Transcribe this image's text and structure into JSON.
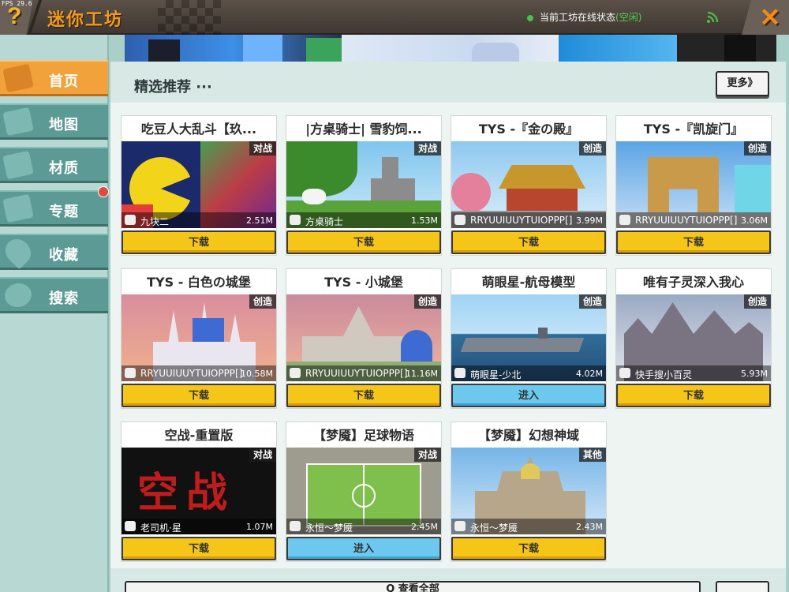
{
  "topbar": {
    "fps": "FPS 29.6",
    "help_icon": "?",
    "app_title": "迷你工坊",
    "status_label": "当前工坊在线状态",
    "status_value": "(空闲)",
    "close_icon": "✕"
  },
  "sidebar": {
    "items": [
      {
        "label": "首页",
        "icon": "home-icon",
        "active": true
      },
      {
        "label": "地图",
        "icon": "map-icon"
      },
      {
        "label": "材质",
        "icon": "texture-icon"
      },
      {
        "label": "专题",
        "icon": "topic-icon"
      },
      {
        "label": "收藏",
        "icon": "heart-icon"
      },
      {
        "label": "搜索",
        "icon": "search-icon"
      }
    ]
  },
  "main": {
    "section_title": "精选推荐 ···",
    "more_label": "更多》",
    "view_all_label": "Q 查看全部"
  },
  "cards": [
    {
      "title": "吃豆人大乱斗【玖...",
      "tag": "对战",
      "author": "九块二",
      "size": "2.51M",
      "button": "下载",
      "button_type": "download",
      "theme": "pacman"
    },
    {
      "title": "|方桌骑士| 雪豹饲...",
      "tag": "对战",
      "author": "方桌骑士",
      "size": "1.53M",
      "button": "下载",
      "button_type": "download",
      "theme": "forest"
    },
    {
      "title": "TYS -『金の殿』",
      "tag": "创造",
      "author": "RRYUUIUUYTUIOPPP[][]",
      "size": "3.99M",
      "button": "下载",
      "button_type": "download",
      "theme": "temple"
    },
    {
      "title": "TYS -『凯旋门』",
      "tag": "创造",
      "author": "RRYUUIUUYTUIOPPP[][]",
      "size": "3.06M",
      "button": "下载",
      "button_type": "download",
      "theme": "arch"
    },
    {
      "title": "TYS - 白色の城堡",
      "tag": "创造",
      "author": "RRYUUIUUYTUIOPPP[][]",
      "size": "10.58M",
      "button": "下载",
      "button_type": "download",
      "theme": "castle-white"
    },
    {
      "title": "TYS - 小城堡",
      "tag": "创造",
      "author": "RRYUUIUUYTUIOPPP[][]",
      "size": "11.16M",
      "button": "下载",
      "button_type": "download",
      "theme": "castle-small"
    },
    {
      "title": "萌眼星-航母模型",
      "tag": "创造",
      "author": "萌眼星-少北",
      "size": "4.02M",
      "button": "进入",
      "button_type": "enter",
      "theme": "carrier"
    },
    {
      "title": "唯有子灵深入我心",
      "tag": "创造",
      "author": "快手搜小百灵",
      "size": "5.93M",
      "button": "下载",
      "button_type": "download",
      "theme": "dark-castle"
    },
    {
      "title": "空战-重置版",
      "tag": "对战",
      "author": "老司机·星",
      "size": "1.07M",
      "button": "下载",
      "button_type": "download",
      "theme": "airwar"
    },
    {
      "title": "【梦魇】足球物语",
      "tag": "对战",
      "author": "永恒～梦魇",
      "size": "2.45M",
      "button": "进入",
      "button_type": "enter",
      "theme": "soccer"
    },
    {
      "title": "【梦魇】幻想神域",
      "tag": "其他",
      "author": "永恒～梦魇",
      "size": "2.43M",
      "button": "下载",
      "button_type": "download",
      "theme": "cathedral"
    }
  ],
  "airwar_text": "空战",
  "colors": {
    "accent_orange": "#f39a1e",
    "download_yellow": "#f5c517",
    "enter_blue": "#6cc8ef",
    "sidebar_teal": "#5c9b95",
    "status_green": "#4fd24f"
  }
}
